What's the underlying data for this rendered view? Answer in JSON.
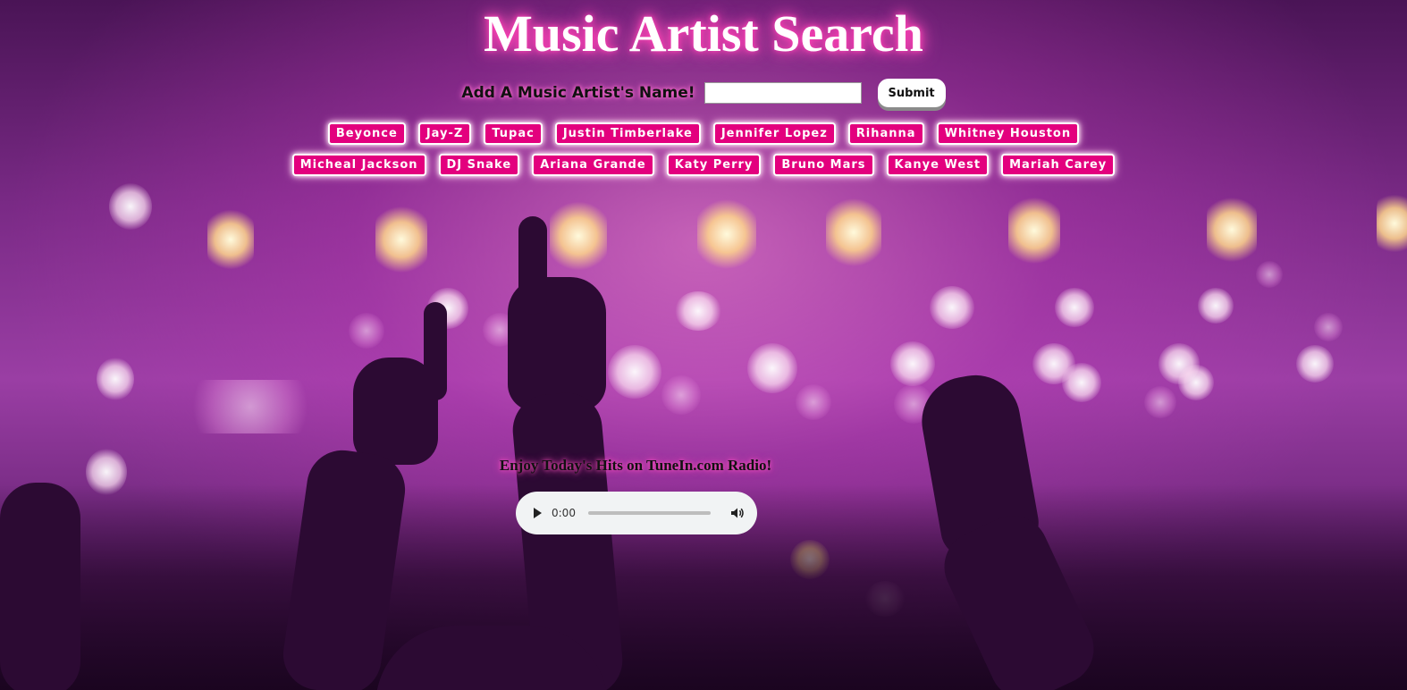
{
  "page": {
    "title": "Music Artist Search"
  },
  "search": {
    "label": "Add A Music Artist's Name!",
    "value": "",
    "placeholder": "",
    "submit_label": "Submit"
  },
  "artists_row1": [
    "Beyonce",
    "Jay-Z",
    "Tupac",
    "Justin Timberlake",
    "Jennifer Lopez",
    "Rihanna",
    "Whitney Houston"
  ],
  "artists_row2": [
    "Micheal Jackson",
    "DJ Snake",
    "Ariana Grande",
    "Katy Perry",
    "Bruno Mars",
    "Kanye West",
    "Mariah Carey"
  ],
  "radio": {
    "caption": "Enjoy Today's Hits on TuneIn.com Radio!",
    "time": "0:00",
    "progress": 0,
    "play_icon": "play-icon",
    "volume_icon": "volume-icon"
  },
  "colors": {
    "artist_button": "#e3007e",
    "glow": "#ff3fb4",
    "background": "#9a3ea4"
  }
}
